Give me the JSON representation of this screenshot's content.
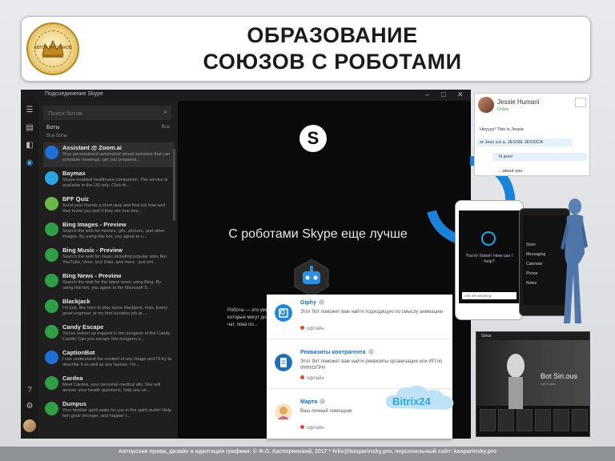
{
  "slide": {
    "title_line1": "ОБРАЗОВАНИЕ",
    "title_line2": "СОЮЗОВ С РОБОТАМИ",
    "logo_text": "АВТОР МАСЛАКОВ",
    "footer": "Авторские права, дизайн и адаптация графики: © Ф.О. Касперинский, 2017 * felix@kasparinsky.pro, персональный сайт: kasparinsky.pro"
  },
  "skype": {
    "window_title": "Подсоединение Skype",
    "search_placeholder": "Поиск ботов",
    "header_bots": "Боты",
    "header_sort": "Все",
    "header_all": "Все боты",
    "bots": [
      {
        "name": "Assistant @ Zoom.ai",
        "desc": "Your personalized automated virtual assistant that can schedule meetings, get you prepared...",
        "color": "#1f6fd6",
        "icon": "zoom-icon"
      },
      {
        "name": "Baymax",
        "desc": "Skype-enabled healthcare companion. The service is available in the US only. Click th...",
        "color": "#2aa5e0",
        "icon": "baymax-icon"
      },
      {
        "name": "BFF Quiz",
        "desc": "Send your friends a short quiz and find out how well they know you and if they are true bes...",
        "color": "#6bb84a",
        "icon": "quiz-icon"
      },
      {
        "name": "Bing Images - Preview",
        "desc": "Search the web for memes, gifs, stickers, and other images. By using this bot, you agree to c...",
        "color": "#2f9e44",
        "icon": "images-icon"
      },
      {
        "name": "Bing Music - Preview",
        "desc": "Search the web for music including popular sites like YouTube, Vevo, lyric links, and more - just ent...",
        "color": "#2f9e44",
        "icon": "music-icon"
      },
      {
        "name": "Bing News - Preview",
        "desc": "Search the web for the latest news using Bing. By using this bot, you agree to the Microsoft S...",
        "color": "#2f9e44",
        "icon": "news-icon"
      },
      {
        "name": "Blackjack",
        "desc": "I'm just, like here to play some blackjack, man. Every great engineer at my first lucrative job at ...",
        "color": "#2f9e44",
        "icon": "cards-icon"
      },
      {
        "name": "Candy Escape",
        "desc": "You've woken up trapped in the dungeon of the Candy Castle! Can you escape this dungeon a...",
        "color": "#2f9e44",
        "icon": "candy-icon"
      },
      {
        "name": "CaptionBot",
        "desc": "I can understand the content of any image and I'll try to describe it as well as any human. I'm...",
        "color": "#1f6fd6",
        "icon": "caption-icon"
      },
      {
        "name": "Cardea",
        "desc": "Meet Cardea, your personal medical ally. She will answer your health questions, help you un...",
        "color": "#2f9e44",
        "icon": "medical-icon"
      },
      {
        "name": "Dumpus",
        "desc": "Your familiar spirit waits for you in the spirit realm! Help him grow stronger, and happier t...",
        "color": "#2f9e44",
        "icon": "spirit-icon"
      }
    ],
    "tagline": "С роботами Skype еще лучше",
    "bot_description": "Роботы — это умные помощники, которые могут досавить их в свой чат, пока по..."
  },
  "jessie_card": {
    "name": "Jessie Humani",
    "status": "Online",
    "messages": [
      "Heyyyy! This is Jessie",
      "or Jess a.k.a. JESSIE JESSICA",
      "hi jess!",
      "...about you"
    ]
  },
  "phone1": {
    "prompt": "You're Sober! How can I help?",
    "input": "Ask me anything"
  },
  "phone2": {
    "items": [
      "Store",
      "Messaging",
      "Calendar",
      "Phone",
      "Notes"
    ]
  },
  "website": {
    "logo": "Sirius",
    "heading": "Bot Siri.ous",
    "sub": "Get it now"
  },
  "overlay": {
    "items": [
      {
        "name": "Giphy",
        "desc": "Этот бот поможет вам найти подходящую по смыслу анимацию",
        "status": "офлайн",
        "color": "#1e88d6"
      },
      {
        "name": "Реквизиты контрагента",
        "desc": "Этот бот поможет вам найти реквизиты организации или ИП по ИНН/ОГРН",
        "status": "офлайн",
        "color": "#1e6fb6"
      },
      {
        "name": "Марта",
        "desc": "Ваш личный помощник",
        "status": "офлайн",
        "color": "#e8a65a"
      }
    ],
    "bitrix": "Bitrix24"
  }
}
